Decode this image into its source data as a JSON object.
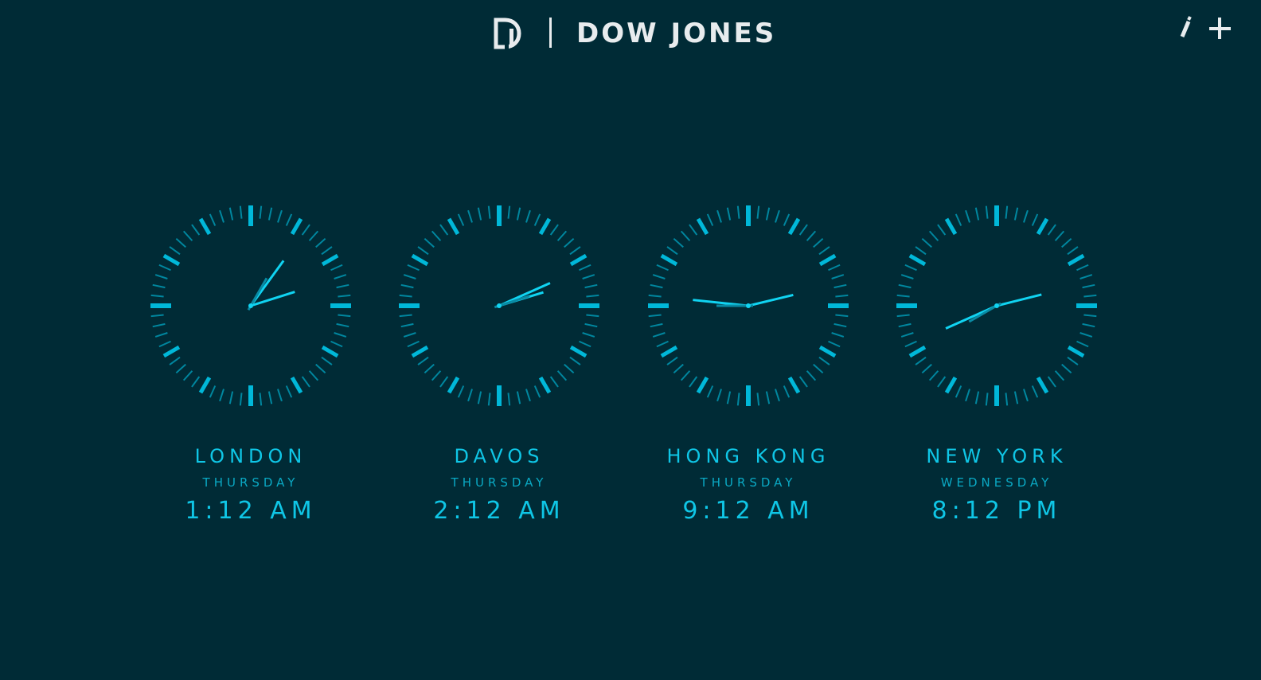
{
  "header": {
    "brand_name": "DOW JONES",
    "logo_icon": "dj-logo-icon",
    "edit_icon": "pencil-icon",
    "add_icon": "plus-icon"
  },
  "colors": {
    "background": "#002b36",
    "accent": "#00b8d9",
    "brand_text": "#e8ecee"
  },
  "clocks": [
    {
      "city": "LONDON",
      "day": "THURSDAY",
      "time": "1:12 AM",
      "hour": 1,
      "minute": 12,
      "second": 5
    },
    {
      "city": "DAVOS",
      "day": "THURSDAY",
      "time": "2:12 AM",
      "hour": 2,
      "minute": 12,
      "second": 12
    },
    {
      "city": "HONG KONG",
      "day": "THURSDAY",
      "time": "9:12 AM",
      "hour": 9,
      "minute": 12,
      "second": 45
    },
    {
      "city": "NEW YORK",
      "day": "WEDNESDAY",
      "time": "8:12 PM",
      "hour": 20,
      "minute": 12,
      "second": 40
    }
  ]
}
